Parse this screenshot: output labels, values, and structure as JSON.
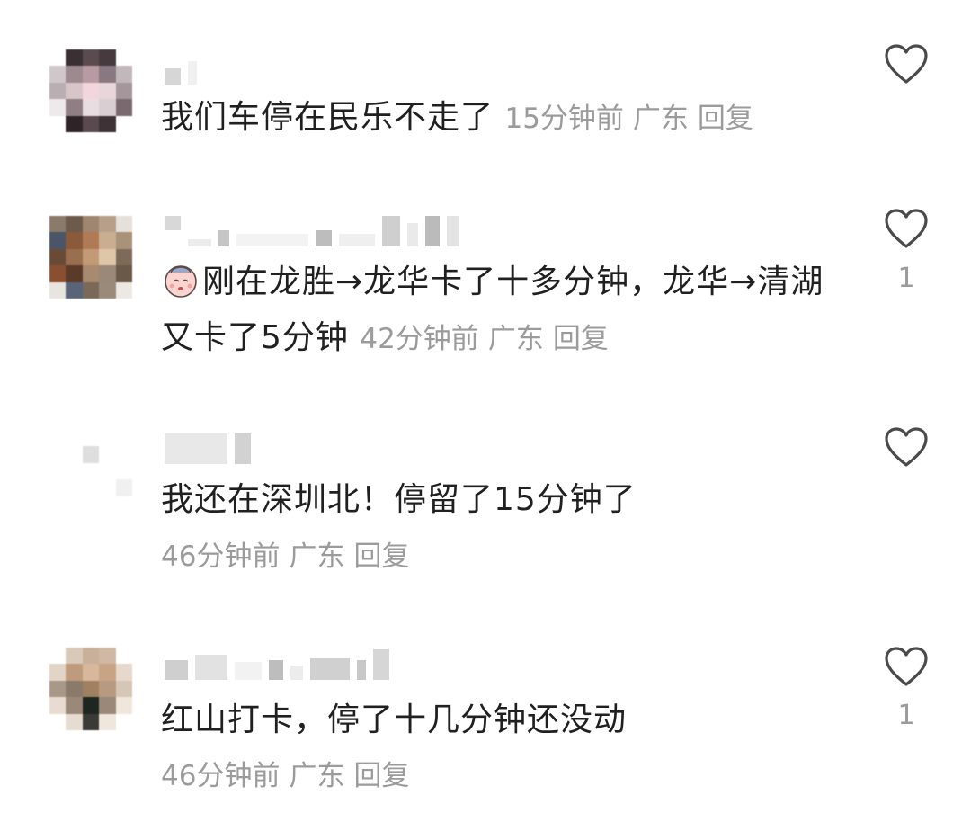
{
  "comments": [
    {
      "text": "我们车停在民乐不走了",
      "time": "15分钟前",
      "location": "广东",
      "reply_label": "回复",
      "likes": ""
    },
    {
      "text": "刚在龙胜→龙华卡了十多分钟，龙华→清湖又卡了5分钟",
      "time": "42分钟前",
      "location": "广东",
      "reply_label": "回复",
      "likes": "1"
    },
    {
      "text": "我还在深圳北！停留了15分钟了",
      "time": "46分钟前",
      "location": "广东",
      "reply_label": "回复",
      "likes": ""
    },
    {
      "text": "红山打卡，停了十几分钟还没动",
      "time": "46分钟前",
      "location": "广东",
      "reply_label": "回复",
      "likes": "1"
    }
  ],
  "icons": {
    "like": "heart-outline-icon",
    "emoji": "sleepy-face-emoji-icon"
  },
  "colors": {
    "text": "#202020",
    "meta": "#9b9b9b",
    "icon": "#4a4a4a"
  }
}
